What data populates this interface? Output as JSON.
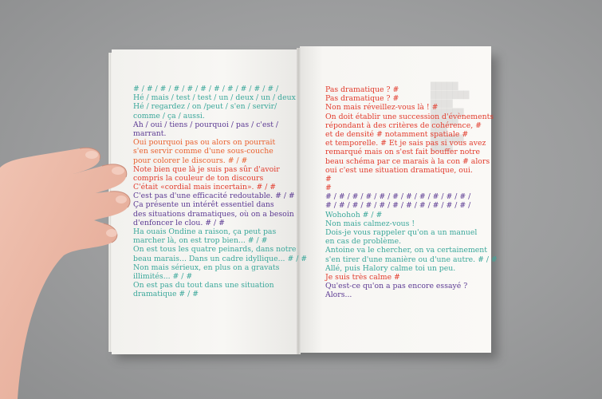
{
  "left_page": {
    "lines": [
      {
        "text": "# / # / # / # / # / # / # / # / # / # / # /",
        "color": "teal"
      },
      {
        "text": "Hé / mais / test / test / un / deux / un / deux",
        "color": "teal"
      },
      {
        "text": "Hé / regardez / on /peut / s'en / servir/",
        "color": "teal"
      },
      {
        "text": "comme / ça / aussi.",
        "color": "teal"
      },
      {
        "text": "Ah / oui / tiens / pourquoi / pas / c'est /",
        "color": "purple"
      },
      {
        "text": "marrant.",
        "color": "purple"
      },
      {
        "text": "Oui pourquoi pas ou alors on pourrait",
        "color": "orange"
      },
      {
        "text": "s'en servir comme d'une sous-couche",
        "color": "orange"
      },
      {
        "text": "pour colorer le discours. # / #",
        "color": "orange"
      },
      {
        "text": "Note bien que là je suis pas sûr d'avoir",
        "color": "red"
      },
      {
        "text": "compris la couleur de ton discours",
        "color": "red"
      },
      {
        "text": "C'était «cordial mais incertain». # / #",
        "color": "red"
      },
      {
        "text": "C'est pas d'une efficacité redoutable. # / #",
        "color": "purple"
      },
      {
        "text": "Ça présente un intérêt essentiel dans",
        "color": "purple"
      },
      {
        "text": "des situations dramatiques, où on a besoin",
        "color": "purple"
      },
      {
        "text": "d'enfoncer le clou. # / #",
        "color": "purple"
      },
      {
        "text": "Ha ouais Ondine a raison, ça peut pas",
        "color": "teal"
      },
      {
        "text": "marcher là, on est trop bien... # / #",
        "color": "teal"
      },
      {
        "text": "On est tous les quatre peinards, dans notre",
        "color": "teal"
      },
      {
        "text": "beau marais... Dans un cadre idyllique... # / #",
        "color": "teal"
      },
      {
        "text": "Non mais sérieux, en plus on a gravats",
        "color": "teal"
      },
      {
        "text": "illimités... # / #",
        "color": "teal"
      },
      {
        "text": "On est pas du tout dans une situation",
        "color": "teal"
      },
      {
        "text": "dramatique # / #",
        "color": "teal"
      }
    ]
  },
  "right_page": {
    "lines": [
      {
        "text": "Pas dramatique ? #",
        "color": "red"
      },
      {
        "text": "Pas dramatique ? #",
        "color": "red"
      },
      {
        "text": "Non mais réveillez-vous là ! #",
        "color": "red"
      },
      {
        "text": "On doit établir une succession d'évènements",
        "color": "red"
      },
      {
        "text": "répondant à des critères de cohérence, #",
        "color": "red"
      },
      {
        "text": "et de densité # notamment spatiale #",
        "color": "red"
      },
      {
        "text": "et temporelle. # Et je sais pas si vous avez",
        "color": "red"
      },
      {
        "text": "remarqué mais on s'est fait bouffer notre",
        "color": "red"
      },
      {
        "text": "beau schéma par ce marais à la con # alors",
        "color": "red"
      },
      {
        "text": "oui c'est une situation dramatique, oui.",
        "color": "red"
      },
      {
        "text": "#",
        "color": "red"
      },
      {
        "text": "#",
        "color": "red"
      },
      {
        "text": "# / # / # / # / # / # / # / # / # / # / # /",
        "color": "purple"
      },
      {
        "text": "# / # / # / # / # / # / # / # / # / # / # /",
        "color": "purple"
      },
      {
        "text": "Wohohoh # / #",
        "color": "teal"
      },
      {
        "text": "Non mais calmez-vous !",
        "color": "teal"
      },
      {
        "text": "Dois-je vous rappeler qu'on a un manuel",
        "color": "teal"
      },
      {
        "text": "en cas de problème.",
        "color": "teal"
      },
      {
        "text": "Antoine va le chercher, on va certainement",
        "color": "teal"
      },
      {
        "text": "s'en tirer d'une manière ou d'une autre. # / #",
        "color": "teal"
      },
      {
        "text": "Allé, puis Halory calme toi un peu.",
        "color": "teal"
      },
      {
        "text": "Je suis très calme #",
        "color": "red"
      },
      {
        "text": "Qu'est-ce qu'on a pas encore essayé ?",
        "color": "purple"
      },
      {
        "text": "Alors...",
        "color": "purple"
      }
    ]
  },
  "colors": {
    "teal": "#3aa79a",
    "purple": "#5c3a93",
    "orange": "#e9612f",
    "red": "#e23b2c",
    "background": "#9a9b9c",
    "paper": "#f7f6f3"
  }
}
